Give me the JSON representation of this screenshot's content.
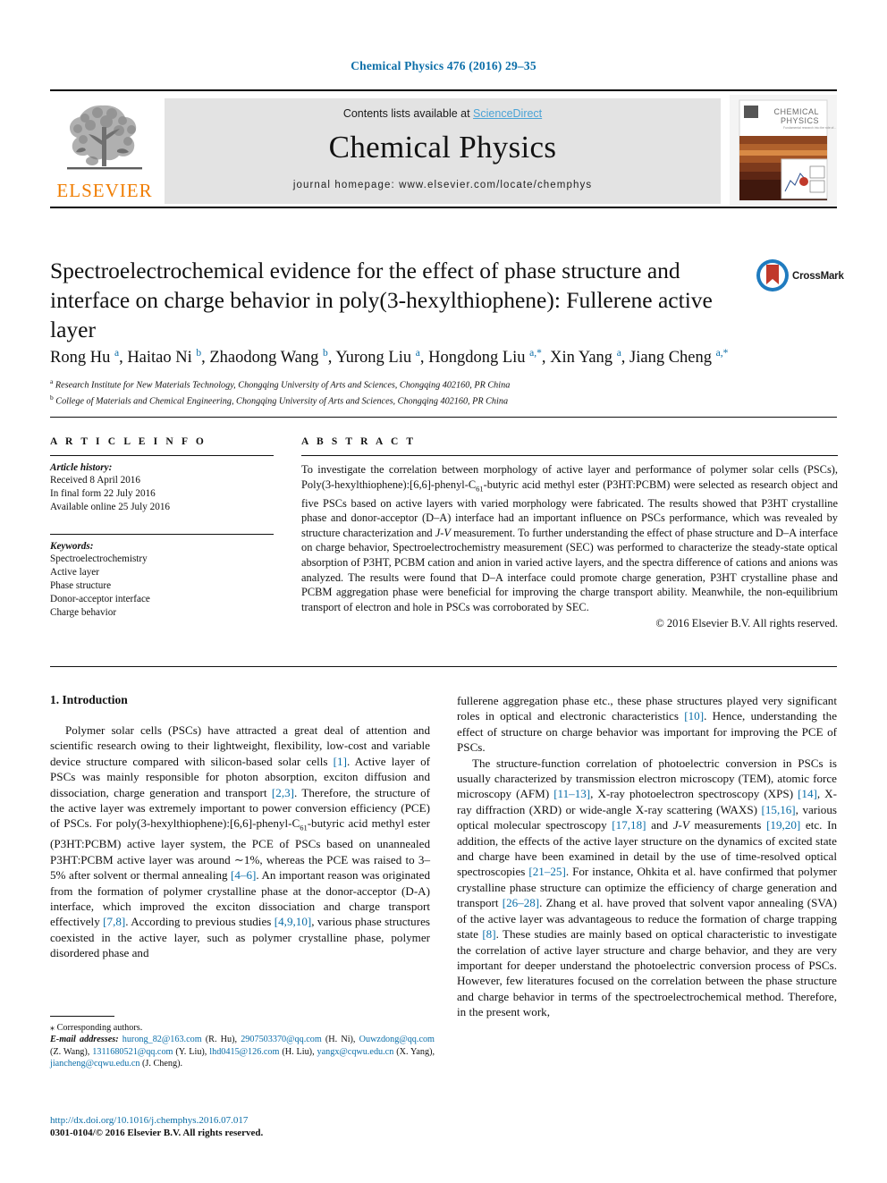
{
  "running_head": "Chemical Physics 476 (2016) 29–35",
  "masthead": {
    "contents_prefix": "Contents lists available at ",
    "sciencedirect": "ScienceDirect",
    "journal_title": "Chemical Physics",
    "homepage": "journal homepage: www.elsevier.com/locate/chemphys",
    "publisher_logo_text": "ELSEVIER",
    "cover_title_line1": "CHEMICAL",
    "cover_title_line2": "PHYSICS",
    "accent_link_color": "#4aa3d6",
    "publisher_orange": "#f07d00"
  },
  "article": {
    "title": "Spectroelectrochemical evidence for the effect of phase structure and interface on charge behavior in poly(3-hexylthiophene): Fullerene active layer",
    "crossmark_label": "CrossMark",
    "authors_html": "Rong Hu <sup>a</sup>, Haitao Ni <sup>b</sup>, Zhaodong Wang <sup>b</sup>, Yurong Liu <sup>a</sup>, Hongdong Liu <sup>a,*</sup>, Xin Yang <sup>a</sup>, Jiang Cheng <sup>a,*</sup>",
    "affiliations": [
      "a Research Institute for New Materials Technology, Chongqing University of Arts and Sciences, Chongqing 402160, PR China",
      "b College of Materials and Chemical Engineering, Chongqing University of Arts and Sciences, Chongqing 402160, PR China"
    ]
  },
  "article_info": {
    "heading": "A R T I C L E  I N F O",
    "history_label": "Article history:",
    "history": [
      "Received 8 April 2016",
      "In final form 22 July 2016",
      "Available online 25 July 2016"
    ],
    "keywords_label": "Keywords:",
    "keywords": [
      "Spectroelectrochemistry",
      "Active layer",
      "Phase structure",
      "Donor-acceptor interface",
      "Charge behavior"
    ]
  },
  "abstract": {
    "heading": "A B S T R A C T",
    "text_html": "To investigate the correlation between morphology of active layer and performance of polymer solar cells (PSCs), Poly(3-hexylthiophene):[6,6]-phenyl-C<sub class=\"chem\">61</sub>-butyric acid methyl ester (P3HT:PCBM) were selected as research object and five PSCs based on active layers with varied morphology were fabricated. The results showed that P3HT crystalline phase and donor-acceptor (D–A) interface had an important influence on PSCs performance, which was revealed by structure characterization and <i>J-V</i> measurement. To further understanding the effect of phase structure and D–A interface on charge behavior, Spectroelectrochemistry measurement (SEC) was performed to characterize the steady-state optical absorption of P3HT, PCBM cation and anion in varied active layers, and the spectra difference of cations and anions was analyzed. The results were found that D–A interface could promote charge generation, P3HT crystalline phase and PCBM aggregation phase were beneficial for improving the charge transport ability. Meanwhile, the non-equilibrium transport of electron and hole in PSCs was corroborated by SEC.",
    "copyright": "© 2016 Elsevier B.V. All rights reserved."
  },
  "body": {
    "section_heading": "1. Introduction",
    "left_paragraphs_html": [
      "Polymer solar cells (PSCs) have attracted a great deal of attention and scientific research owing to their lightweight, flexibility, low-cost and variable device structure compared with silicon-based solar cells <span class=\"ref\">[1]</span>. Active layer of PSCs was mainly responsible for photon absorption, exciton diffusion and dissociation, charge generation and transport <span class=\"ref\">[2,3]</span>. Therefore, the structure of the active layer was extremely important to power conversion efficiency (PCE) of PSCs. For poly(3-hexylthiophene):[6,6]-phenyl-C<sub class=\"chem\">61</sub>-butyric acid methyl ester (P3HT:PCBM) active layer system, the PCE of PSCs based on unannealed P3HT:PCBM active layer was around ∼1%, whereas the PCE was raised to 3–5% after solvent or thermal annealing <span class=\"ref\">[4–6]</span>. An important reason was originated from the formation of polymer crystalline phase at the donor-acceptor (D-A) interface, which improved the exciton dissociation and charge transport effectively <span class=\"ref\">[7,8]</span>. According to previous studies <span class=\"ref\">[4,9,10]</span>, various phase structures coexisted in the active layer, such as polymer crystalline phase, polymer disordered phase and"
    ],
    "right_paragraphs_html": [
      "fullerene aggregation phase etc., these phase structures played very significant roles in optical and electronic characteristics <span class=\"ref\">[10]</span>. Hence, understanding the effect of structure on charge behavior was important for improving the PCE of PSCs.",
      "The structure-function correlation of photoelectric conversion in PSCs is usually characterized by transmission electron microscopy (TEM), atomic force microscopy (AFM) <span class=\"ref\">[11–13]</span>, X-ray photoelectron spectroscopy (XPS) <span class=\"ref\">[14]</span>, X-ray diffraction (XRD) or wide-angle X-ray scattering (WAXS) <span class=\"ref\">[15,16]</span>, various optical molecular spectroscopy <span class=\"ref\">[17,18]</span> and <i>J-V</i> measurements <span class=\"ref\">[19,20]</span> etc. In addition, the effects of the active layer structure on the dynamics of excited state and charge have been examined in detail by the use of time-resolved optical spectroscopies <span class=\"ref\">[21–25]</span>. For instance, Ohkita et al. have confirmed that polymer crystalline phase structure can optimize the efficiency of charge generation and transport <span class=\"ref\">[26–28]</span>. Zhang et al. have proved that solvent vapor annealing (SVA) of the active layer was advantageous to reduce the formation of charge trapping state <span class=\"ref\">[8]</span>. These studies are mainly based on optical characteristic to investigate the correlation of active layer structure and charge behavior, and they are very important for deeper understand the photoelectric conversion process of PSCs. However, few literatures focused on the correlation between the phase structure and charge behavior in terms of the spectroelectrochemical method. Therefore, in the present work,"
    ]
  },
  "footnote": {
    "corresponding": "⁎ Corresponding authors.",
    "email_label": "E-mail addresses:",
    "emails_html": " <span class=\"lnk\">hurong_82@163.com</span> (R. Hu), <span class=\"lnk\">2907503370@qq.com</span> (H. Ni), <span class=\"lnk\">Ouwzdong@qq.com</span> (Z. Wang), <span class=\"lnk\">1311680521@qq.com</span> (Y. Liu), <span class=\"lnk\">lhd0415@126.com</span> (H. Liu), <span class=\"lnk\">yangx@cqwu.edu.cn</span> (X. Yang), <span class=\"lnk\">jiancheng@cqwu.edu.cn</span> (J. Cheng).",
    "doi": "http://dx.doi.org/10.1016/j.chemphys.2016.07.017",
    "issn": "0301-0104/© 2016 Elsevier B.V. All rights reserved."
  }
}
